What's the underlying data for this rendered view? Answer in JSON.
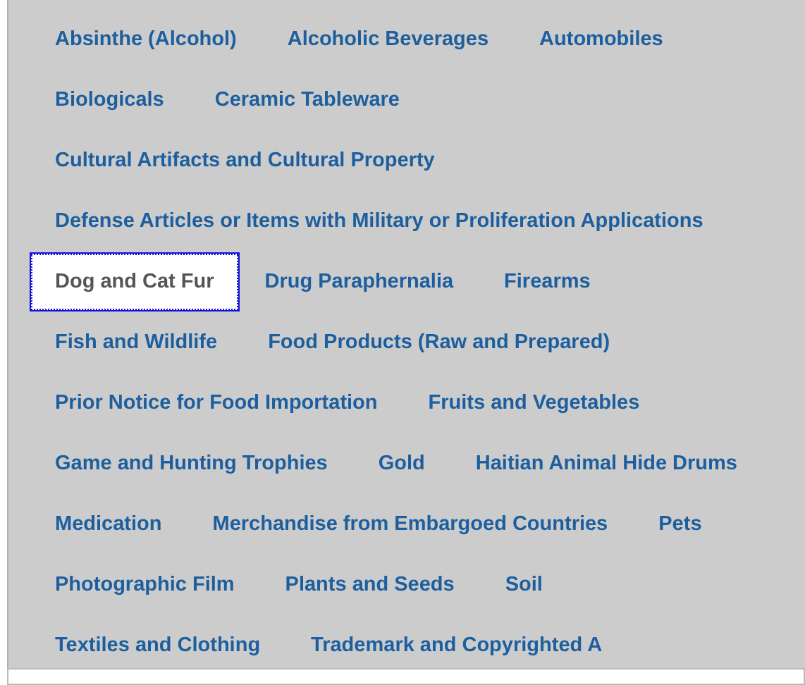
{
  "rows": [
    [
      {
        "label": "Absinthe (Alcohol)",
        "selected": false
      },
      {
        "label": "Alcoholic Beverages",
        "selected": false
      },
      {
        "label": "Automobiles",
        "selected": false
      }
    ],
    [
      {
        "label": "Biologicals",
        "selected": false
      },
      {
        "label": "Ceramic Tableware",
        "selected": false
      }
    ],
    [
      {
        "label": "Cultural Artifacts and Cultural Property",
        "selected": false
      }
    ],
    [
      {
        "label": "Defense Articles or Items with Military or Proliferation Applications",
        "selected": false
      }
    ],
    [
      {
        "label": "Dog and Cat Fur",
        "selected": true
      },
      {
        "label": "Drug Paraphernalia",
        "selected": false
      },
      {
        "label": "Firearms",
        "selected": false
      }
    ],
    [
      {
        "label": "Fish and Wildlife",
        "selected": false
      },
      {
        "label": "Food Products (Raw and Prepared)",
        "selected": false
      }
    ],
    [
      {
        "label": "Prior Notice for Food Importation",
        "selected": false
      },
      {
        "label": "Fruits and Vegetables",
        "selected": false
      }
    ],
    [
      {
        "label": "Game and Hunting Trophies",
        "selected": false
      },
      {
        "label": "Gold",
        "selected": false
      },
      {
        "label": "Haitian Animal Hide Drums",
        "selected": false
      }
    ],
    [
      {
        "label": "Medication",
        "selected": false
      },
      {
        "label": "Merchandise from Embargoed Countries",
        "selected": false
      },
      {
        "label": "Pets",
        "selected": false
      }
    ],
    [
      {
        "label": "Photographic Film",
        "selected": false
      },
      {
        "label": "Plants and Seeds",
        "selected": false
      },
      {
        "label": "Soil",
        "selected": false
      }
    ],
    [
      {
        "label": "Textiles and Clothing",
        "selected": false
      },
      {
        "label": "Trademark and Copyrighted A",
        "selected": false
      }
    ]
  ]
}
